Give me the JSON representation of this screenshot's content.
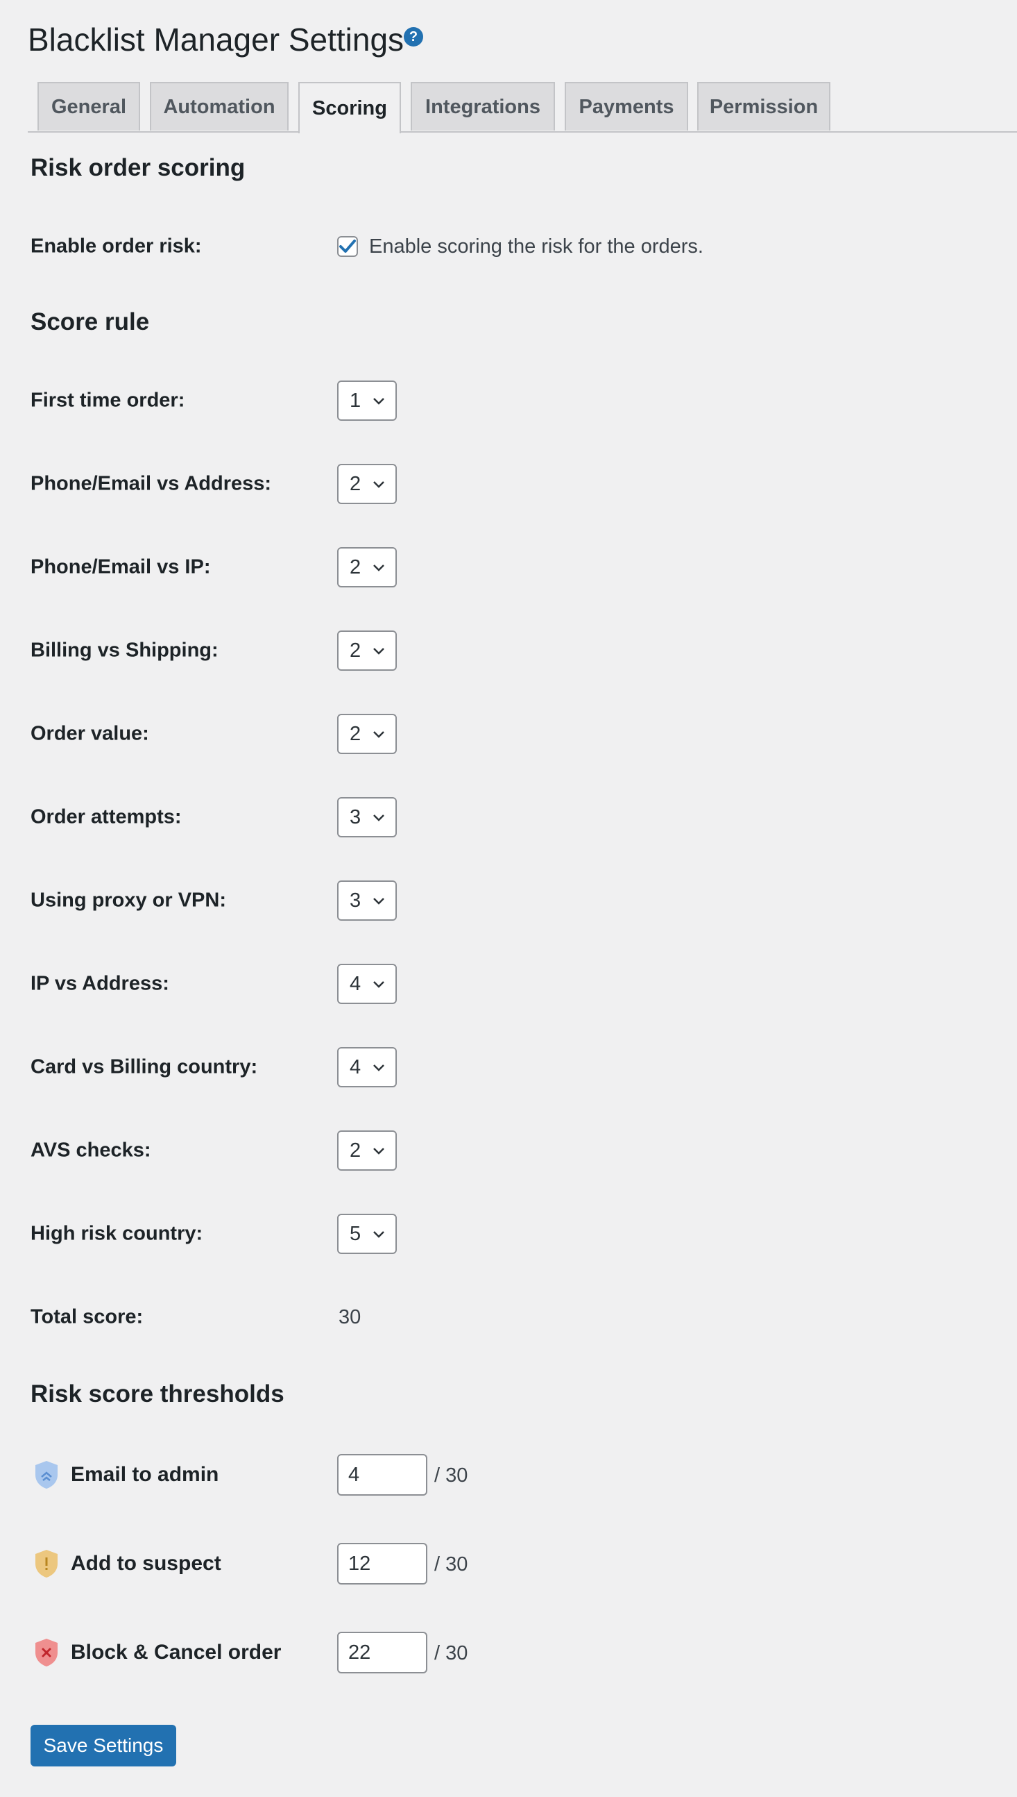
{
  "page": {
    "title": "Blacklist Manager Settings",
    "help_icon": "?"
  },
  "tabs": [
    {
      "label": "General"
    },
    {
      "label": "Automation"
    },
    {
      "label": "Scoring",
      "active": true
    },
    {
      "label": "Integrations"
    },
    {
      "label": "Payments"
    },
    {
      "label": "Permission"
    }
  ],
  "risk_scoring": {
    "title": "Risk order scoring",
    "enable_label": "Enable order risk:",
    "enable_checked": true,
    "enable_desc": "Enable scoring the risk for the orders."
  },
  "score_rule": {
    "title": "Score rule",
    "rules": [
      {
        "label": "First time order:",
        "value": "1"
      },
      {
        "label": "Phone/Email vs Address:",
        "value": "2"
      },
      {
        "label": "Phone/Email vs IP:",
        "value": "2"
      },
      {
        "label": "Billing vs Shipping:",
        "value": "2"
      },
      {
        "label": "Order value:",
        "value": "2"
      },
      {
        "label": "Order attempts:",
        "value": "3"
      },
      {
        "label": "Using proxy or VPN:",
        "value": "3"
      },
      {
        "label": "IP vs Address:",
        "value": "4"
      },
      {
        "label": "Card vs Billing country:",
        "value": "4"
      },
      {
        "label": "AVS checks:",
        "value": "2"
      },
      {
        "label": "High risk country:",
        "value": "5"
      }
    ],
    "total_label": "Total score:",
    "total_value": "30"
  },
  "thresholds": {
    "title": "Risk score thresholds",
    "items": [
      {
        "label": "Email to admin",
        "value": "4",
        "max": "/ 30",
        "icon": "shield-info-icon",
        "color": "#a9c7ee",
        "mark_color": "#5b8fd1"
      },
      {
        "label": "Add to suspect",
        "value": "12",
        "max": "/ 30",
        "icon": "shield-warning-icon",
        "color": "#ecc77f",
        "mark_color": "#b8861f"
      },
      {
        "label": "Block & Cancel order",
        "value": "22",
        "max": "/ 30",
        "icon": "shield-block-icon",
        "color": "#ef8f8f",
        "mark_color": "#c0262c"
      }
    ]
  },
  "save_label": "Save Settings",
  "colors": {
    "accent": "#2271b1",
    "background": "#f0f0f1"
  }
}
